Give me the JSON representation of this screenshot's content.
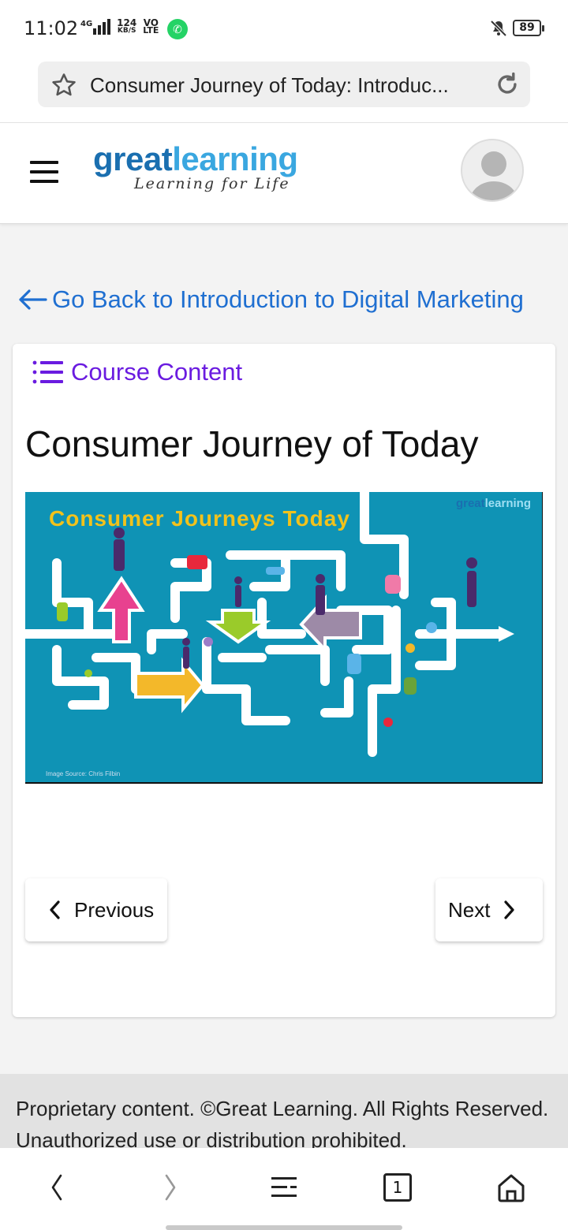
{
  "status_bar": {
    "time": "11:02",
    "network_type": "4G",
    "data_speed_value": "124",
    "data_speed_unit": "KB/S",
    "volte_top": "VO",
    "volte_bottom": "LTE",
    "battery_level": "89"
  },
  "browser": {
    "page_title": "Consumer Journey of Today: Introduc..."
  },
  "site": {
    "logo_great": "great",
    "logo_learning": "learning",
    "logo_tagline": "Learning for Life"
  },
  "navigation": {
    "back_link": "Go Back to Introduction to Digital Marketing"
  },
  "content": {
    "course_content_label": "Course Content",
    "lesson_title": "Consumer Journey of Today",
    "slide": {
      "title": "Consumer Journeys Today",
      "logo_great": "great",
      "logo_learning": "learning",
      "source_caption": "Image Source: Chris Filbin"
    },
    "previous_label": "Previous",
    "next_label": "Next"
  },
  "footer": {
    "text": "Proprietary content. ©Great Learning. All Rights Reserved. Unauthorized use or distribution prohibited."
  },
  "system_nav": {
    "tab_count": "1"
  },
  "colors": {
    "link_blue": "#1f6fd1",
    "course_purple": "#6a1be0",
    "slide_bg": "#0f93b5",
    "slide_title": "#f2c21b"
  }
}
